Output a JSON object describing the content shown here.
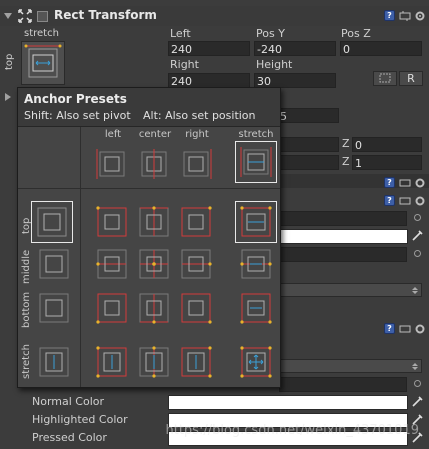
{
  "component": {
    "title": "Rect Transform",
    "anchor_widget": {
      "horizontal": "stretch",
      "vertical": "top"
    }
  },
  "fields": {
    "left_label": "Left",
    "left_value": "240",
    "posy_label": "Pos Y",
    "posy_value": "-240",
    "posz_label": "Pos Z",
    "posz_value": "0",
    "right_label": "Right",
    "right_value": "240",
    "height_label": "Height",
    "height_value": "30",
    "r_button": "R",
    "partial_value_5": "5",
    "z_label_1": "Z",
    "z_value_1": "0",
    "z_label_2": "Z",
    "z_value_2": "1"
  },
  "popup": {
    "title": "Anchor Presets",
    "shift_hint": "Shift: Also set pivot",
    "alt_hint": "Alt: Also set position",
    "columns": [
      "left",
      "center",
      "right",
      "stretch"
    ],
    "rows": [
      "top",
      "middle",
      "bottom",
      "stretch"
    ]
  },
  "colors": {
    "normal_label": "Normal Color",
    "highlighted_label": "Highlighted Color",
    "pressed_label": "Pressed Color"
  },
  "watermark": "https://blog.csdn.net/weixin_43701019",
  "accent": {
    "anchor_red": "#d23b3b",
    "anchor_yellow": "#e8b32b",
    "pivot_blue": "#3aa0d8"
  }
}
